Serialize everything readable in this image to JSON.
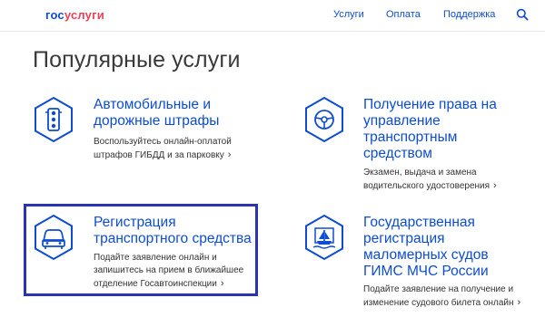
{
  "header": {
    "logo_part1": "гос",
    "logo_part2": "услуги",
    "nav": [
      "Услуги",
      "Оплата",
      "Поддержка"
    ],
    "search_icon": "search-icon"
  },
  "page_title": "Популярные услуги",
  "cards": [
    {
      "icon": "traffic-light-icon",
      "title_lines": [
        "Автомобильные и",
        "дорожные штрафы"
      ],
      "desc_lines": [
        "Воспользуйтесь онлайн-оплатой",
        "штрафов ГИБДД и за парковку"
      ]
    },
    {
      "icon": "steering-wheel-icon",
      "title_lines": [
        "Получение права на",
        "управление",
        "транспортным",
        "средством"
      ],
      "desc_lines": [
        "Экзамен, выдача и замена",
        "водительского удостоверения"
      ]
    },
    {
      "icon": "car-icon",
      "title_lines": [
        "Регистрация",
        "транспортного средства"
      ],
      "desc_lines": [
        "Подайте заявление онлайн и",
        "запишитесь на прием в ближайшее",
        "отделение Госавтоинспекции"
      ]
    },
    {
      "icon": "boat-icon",
      "title_lines": [
        "Государственная",
        "регистрация",
        "маломерных судов",
        "ГИМС МЧС России"
      ],
      "desc_lines": [
        "Подайте заявление на получение и",
        "изменение судового билета онлайн"
      ]
    }
  ],
  "colors": {
    "brand_blue": "#0d4cd3",
    "brand_red": "#ee3f58",
    "highlight": "#2b33b5"
  }
}
